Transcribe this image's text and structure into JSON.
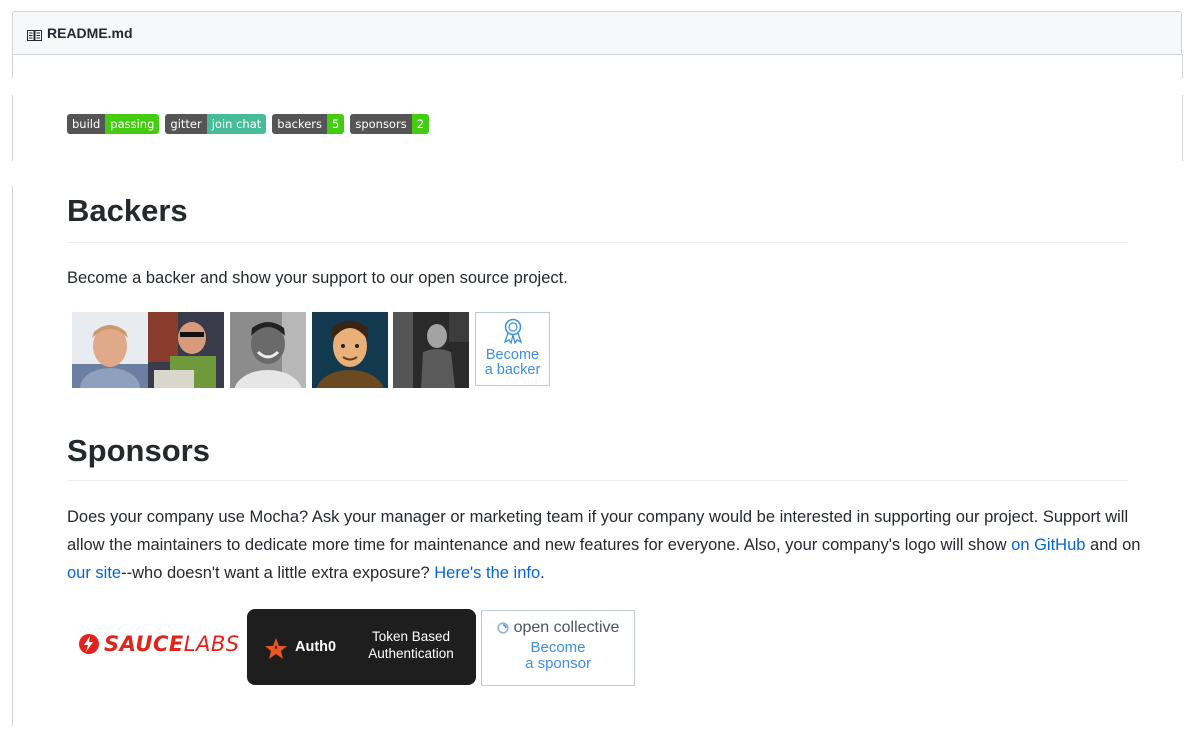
{
  "readme": {
    "filename": "README.md"
  },
  "badges": [
    {
      "label": "build",
      "value": "passing",
      "color": "#44cc11"
    },
    {
      "label": "gitter",
      "value": "join chat",
      "color": "#46bc99"
    },
    {
      "label": "backers",
      "value": "5",
      "color": "#44cc11"
    },
    {
      "label": "sponsors",
      "value": "2",
      "color": "#44cc11"
    }
  ],
  "backers": {
    "heading": "Backers",
    "intro": "Become a backer and show your support to our open source project.",
    "become_line1": "Become",
    "become_line2": "a backer"
  },
  "sponsors": {
    "heading": "Sponsors",
    "text_part1": "Does your company use Mocha? Ask your manager or marketing team if your company would be interested in supporting our project. Support will allow the maintainers to dedicate more time for maintenance and new features for everyone. Also, your company's logo will show ",
    "link_github": "on GitHub",
    "text_part2": " and on ",
    "link_site": "our site",
    "text_part3": "--who doesn't want a little extra exposure? ",
    "link_info": "Here's the info",
    "text_part4": ".",
    "saucelabs_sauce": "SAUCE",
    "saucelabs_labs": "LABS",
    "auth0_name": "Auth0",
    "auth0_tag1": "Token Based",
    "auth0_tag2": "Authentication",
    "oc_name": "open collective",
    "oc_become1": "Become",
    "oc_become2": "a sponsor"
  },
  "colors": {
    "link": "#0366d6",
    "saucelabs_red": "#e2231a",
    "auth0_orange": "#eb5424"
  }
}
